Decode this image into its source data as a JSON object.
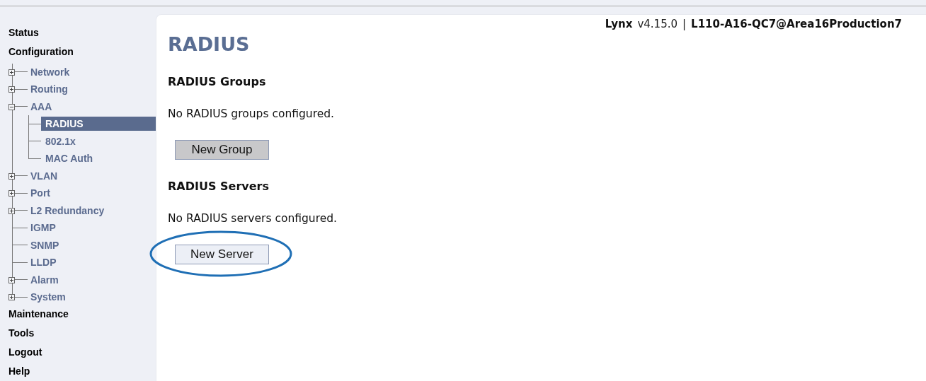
{
  "sidebar": {
    "top": [
      {
        "label": "Status",
        "selected": false
      },
      {
        "label": "Configuration",
        "selected": false
      }
    ],
    "tree": [
      {
        "label": "Network",
        "expanded": false,
        "selected": false
      },
      {
        "label": "Routing",
        "expanded": false,
        "selected": false
      },
      {
        "label": "AAA",
        "expanded": true,
        "selected": false,
        "children": [
          {
            "label": "RADIUS",
            "selected": true
          },
          {
            "label": "802.1x",
            "selected": false
          },
          {
            "label": "MAC Auth",
            "selected": false
          }
        ]
      },
      {
        "label": "VLAN",
        "expanded": false,
        "selected": false
      },
      {
        "label": "Port",
        "expanded": false,
        "selected": false
      },
      {
        "label": "L2 Redundancy",
        "expanded": false,
        "selected": false
      },
      {
        "label": "IGMP",
        "selected": false
      },
      {
        "label": "SNMP",
        "selected": false
      },
      {
        "label": "LLDP",
        "selected": false
      },
      {
        "label": "Alarm",
        "expanded": false,
        "selected": false
      },
      {
        "label": "System",
        "expanded": false,
        "selected": false
      }
    ],
    "bottom": [
      {
        "label": "Maintenance",
        "selected": false
      },
      {
        "label": "Tools",
        "selected": false
      },
      {
        "label": "Logout",
        "selected": false
      },
      {
        "label": "Help",
        "selected": false
      }
    ]
  },
  "header": {
    "product": "Lynx",
    "version": "v4.15.0",
    "separator": "|",
    "device": "L110-A16-QC7@Area16Production7"
  },
  "page": {
    "title": "RADIUS",
    "sections": [
      {
        "heading": "RADIUS Groups",
        "message": "No RADIUS groups configured.",
        "button": {
          "label": "New Group",
          "highlighted": true
        }
      },
      {
        "heading": "RADIUS Servers",
        "message": "No RADIUS servers configured.",
        "button": {
          "label": "New Server",
          "highlighted": false,
          "circled": true
        }
      }
    ]
  }
}
